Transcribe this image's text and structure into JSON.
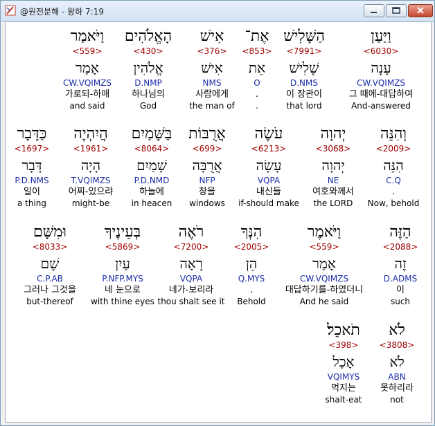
{
  "window": {
    "title": "@원전분해 - 왕하 7:19"
  },
  "rows": [
    [
      {
        "heb": "וַיֹּאמַר",
        "num": "<559>",
        "lemma": "אָמַר",
        "morph": "CW.VQIMZS",
        "kor": "가로되-하매",
        "eng": "and said"
      },
      {
        "heb": "הָאֱלֹהִים",
        "num": "<430>",
        "lemma": "אֱלֹהִין",
        "morph": "D.NMP",
        "kor": "하나님의",
        "eng": "God"
      },
      {
        "heb": "אִישׁ",
        "num": "<376>",
        "lemma": "אִישׁ",
        "morph": "NMS",
        "kor": "사람에게",
        "eng": "the man of"
      },
      {
        "heb": "אֶת־",
        "num": "<853>",
        "lemma": "אֵת",
        "morph": "O",
        "kor": ".",
        "eng": "."
      },
      {
        "heb": "הַשָּׁלִישׁ",
        "num": "<7991>",
        "lemma": "שָׁלִישׁ",
        "morph": "D.NMS",
        "kor": "이 장관이",
        "eng": "that lord"
      },
      {
        "heb": "וַיַּעַן",
        "num": "<6030>",
        "lemma": "עָנָה",
        "morph": "CW.VQIMZS",
        "kor": "그 때에-대답하여",
        "eng": "And-answered"
      }
    ],
    [
      {
        "heb": "כַּדָּבָר",
        "num": "<1697>",
        "lemma": "דָּבָר",
        "morph": "P.D.NMS",
        "kor": "일이",
        "eng": "a thing"
      },
      {
        "heb": "הֲיִהְיֶה",
        "num": "<1961>",
        "lemma": "הָיָה",
        "morph": "T.VQIMZS",
        "kor": "어찌-있으랴",
        "eng": "might-be"
      },
      {
        "heb": "בַּשָּׁמַיִם",
        "num": "<8064>",
        "lemma": "שָׁמַיִם",
        "morph": "P.D.NMD",
        "kor": "하늘에",
        "eng": "in heacen"
      },
      {
        "heb": "אֲרֻבּוֹת",
        "num": "<699>",
        "lemma": "אֲרֻבָּה",
        "morph": "NFP",
        "kor": "창을",
        "eng": "windows"
      },
      {
        "heb": "עֹשֶׂה",
        "num": "<6213>",
        "lemma": "עָשָׂה",
        "morph": "VQPA",
        "kor": "내신들",
        "eng": "if-should make"
      },
      {
        "heb": "יְהוָה",
        "num": "<3068>",
        "lemma": "יְהוָה",
        "morph": "NE",
        "kor": "여호와께서",
        "eng": "the LORD"
      },
      {
        "heb": "וְהִנֵּה",
        "num": "<2009>",
        "lemma": "הִנֵּה",
        "morph": "C.Q",
        "kor": ".",
        "eng": "Now, behold"
      }
    ],
    [
      {
        "heb": "וּמִשָּׁם",
        "num": "<8033>",
        "lemma": "שָׁם",
        "morph": "C.P.AB",
        "kor": "그러나 그것을",
        "eng": "but-thereof"
      },
      {
        "heb": "בְּעֵינֶיךָ",
        "num": "<5869>",
        "lemma": "עַיִן",
        "morph": "P.NFP.MYS",
        "kor": "네 눈으로",
        "eng": "with thine eyes"
      },
      {
        "heb": "רֹאֶה",
        "num": "<7200>",
        "lemma": "רָאָה",
        "morph": "VQPA",
        "kor": "네가-보리라",
        "eng": "thou shalt see it"
      },
      {
        "heb": "הִנְּךָ",
        "num": "<2005>",
        "lemma": "הֵן",
        "morph": "Q.MYS",
        "kor": ".",
        "eng": "Behold"
      },
      {
        "heb": "וַיֹּאמֶר",
        "num": "<559>",
        "lemma": "אָמַר",
        "morph": "CW.VQIMZS",
        "kor": "대답하기를-하였더니",
        "eng": "And he said"
      },
      {
        "heb": "הַזֶּה",
        "num": "<2088>",
        "lemma": "זֶה",
        "morph": "D.ADMS",
        "kor": "이",
        "eng": "such"
      }
    ],
    [
      {
        "heb": "תֹאכֵל׃",
        "num": "<398>",
        "lemma": "אָכַל",
        "morph": "VQIMYS",
        "kor": "먹지는",
        "eng": "shalt-eat"
      },
      {
        "heb": "לֹא",
        "num": "<3808>",
        "lemma": "לֹא",
        "morph": "ABN",
        "kor": "못하리라",
        "eng": "not"
      }
    ]
  ]
}
